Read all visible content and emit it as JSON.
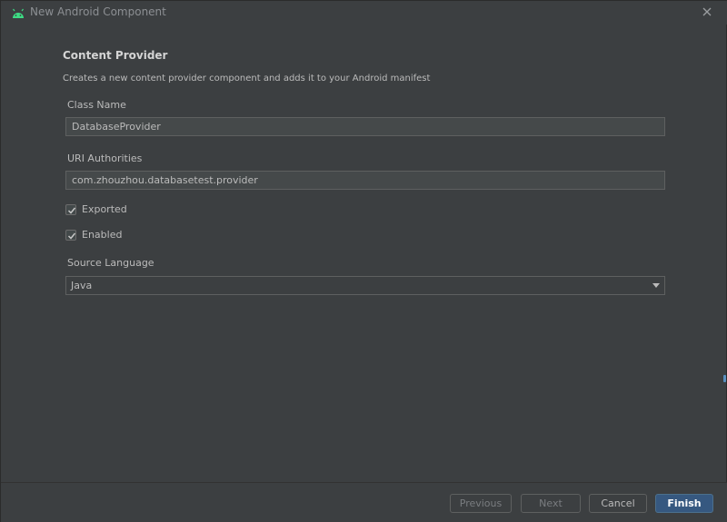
{
  "window": {
    "title": "New Android Component"
  },
  "page": {
    "heading": "Content Provider",
    "subtitle": "Creates a new content provider component and adds it to your Android manifest"
  },
  "form": {
    "class_name": {
      "label": "Class Name",
      "value": "DatabaseProvider"
    },
    "uri_authorities": {
      "label": "URI Authorities",
      "value": "com.zhouzhou.databasetest.provider"
    },
    "exported": {
      "label": "Exported",
      "checked": true
    },
    "enabled": {
      "label": "Enabled",
      "checked": true
    },
    "source_language": {
      "label": "Source Language",
      "value": "Java"
    }
  },
  "footer": {
    "previous_label": "Previous",
    "next_label": "Next",
    "cancel_label": "Cancel",
    "finish_label": "Finish"
  },
  "colors": {
    "background": "#3c3f41",
    "field_background": "#45494a",
    "primary_button": "#365880",
    "android_green": "#3ddc84"
  },
  "icons": {
    "app": "android-icon",
    "close": "close-icon",
    "check": "check-icon",
    "dropdown": "chevron-down-icon"
  }
}
